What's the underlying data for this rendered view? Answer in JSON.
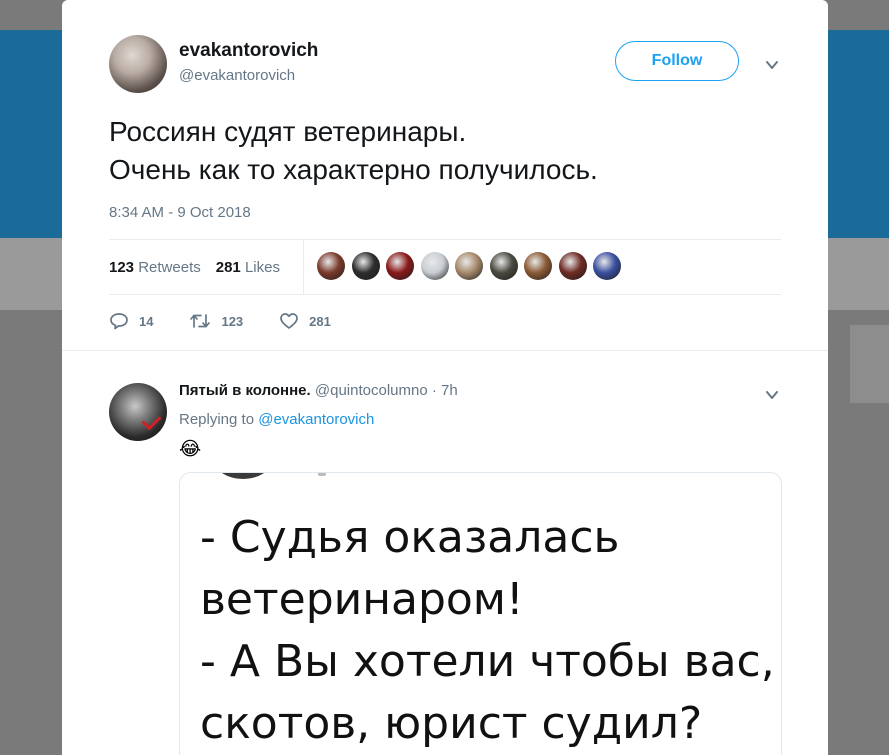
{
  "tweet": {
    "display_name": "evakantorovich",
    "handle": "@evakantorovich",
    "follow_label": "Follow",
    "text_lines": [
      "Россиян судят ветеринары.",
      "Очень как то характерно получилось."
    ],
    "timestamp": "8:34 AM - 9 Oct 2018",
    "stats": {
      "retweets_count": "123",
      "retweets_label": "Retweets",
      "likes_count": "281",
      "likes_label": "Likes"
    },
    "liker_avatar_colors": [
      "#7b3b2c",
      "#2d2d2d",
      "#8a1a1a",
      "#c9ced3",
      "#a88a6c",
      "#4b4a40",
      "#8c5a36",
      "#6e2c24",
      "#3a4fa0"
    ],
    "actions": {
      "reply_count": "14",
      "retweet_count": "123",
      "like_count": "281"
    }
  },
  "reply": {
    "name": "Пятый в колонне.",
    "handle": "@quintocolumno",
    "time": "· 7h",
    "replying_prefix": "Replying to",
    "replying_to": "@evakantorovich",
    "emoji": "😂",
    "media_text_lines": [
      "- Судья оказалась",
      "ветеринаром!",
      "- А Вы хотели чтобы вас,",
      "скотов, юрист судил?"
    ]
  },
  "colors": {
    "accent": "#1da1f2",
    "link": "#1b95e0",
    "secondary_text": "#657786",
    "primary_text": "#14171a"
  }
}
